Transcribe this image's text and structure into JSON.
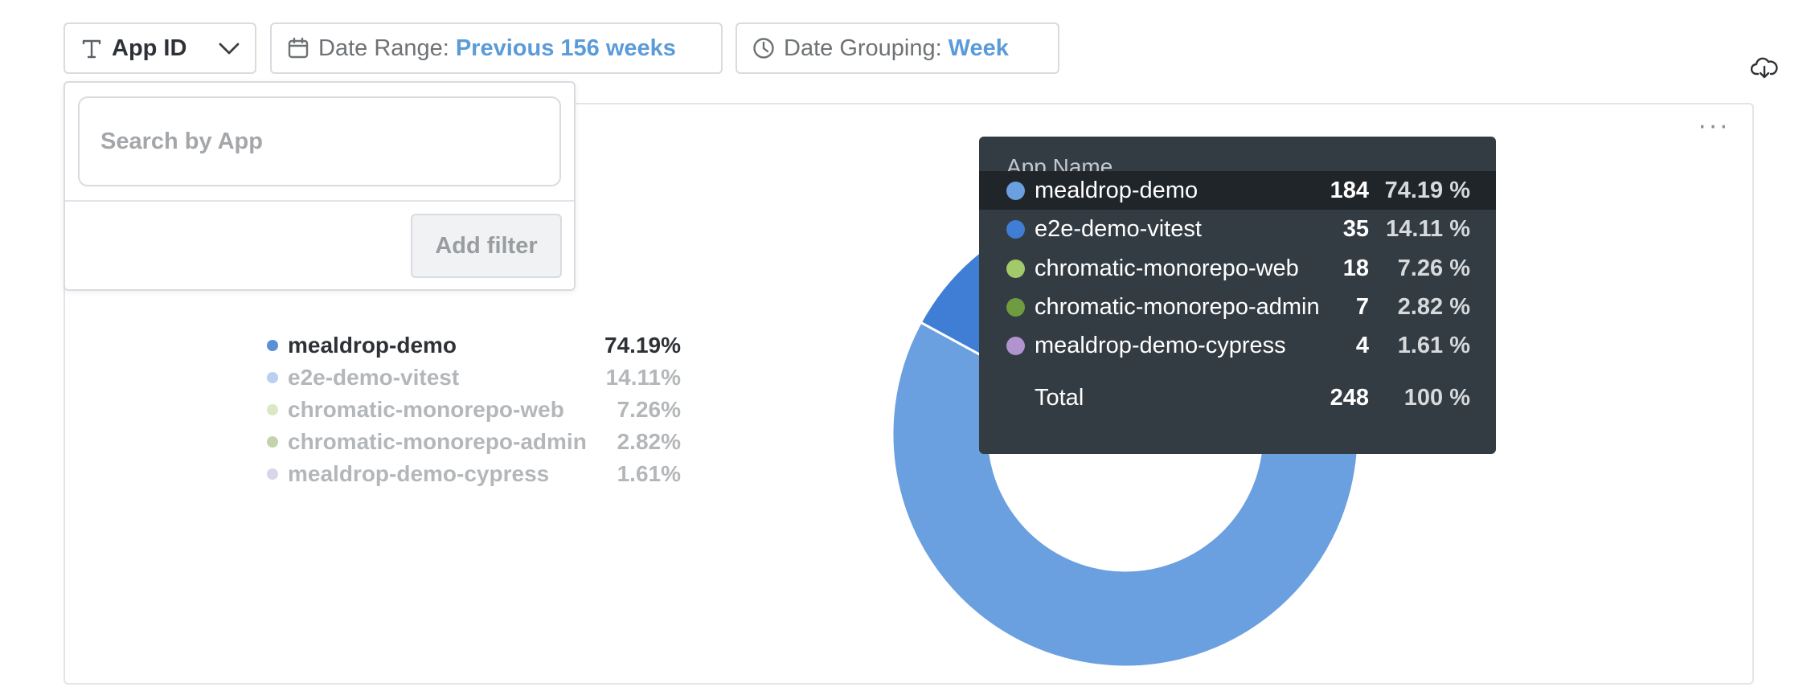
{
  "toolbar": {
    "app_id_label": "App ID",
    "date_range_label": "Date Range:",
    "date_range_value": "Previous 156 weeks",
    "date_grouping_label": "Date Grouping:",
    "date_grouping_value": "Week",
    "icons": {
      "app_id": "text-type-icon",
      "app_id_chevron": "chevron-down-icon",
      "date_range": "calendar-icon",
      "date_grouping": "clock-icon",
      "download": "cloud-download-icon",
      "more": "more-options-icon"
    }
  },
  "popover": {
    "search_placeholder": "Search by App",
    "add_filter_label": "Add filter"
  },
  "legend": {
    "items": [
      {
        "name": "mealdrop-demo",
        "pct": "74.19%",
        "color": "#5b8fd6",
        "active": true
      },
      {
        "name": "e2e-demo-vitest",
        "pct": "14.11%",
        "color": "#b9d0ef",
        "active": false
      },
      {
        "name": "chromatic-monorepo-web",
        "pct": "7.26%",
        "color": "#d9e9c4",
        "active": false
      },
      {
        "name": "chromatic-monorepo-admin",
        "pct": "2.82%",
        "color": "#c3d4ad",
        "active": false
      },
      {
        "name": "mealdrop-demo-cypress",
        "pct": "1.61%",
        "color": "#dcd4e8",
        "active": false
      }
    ]
  },
  "tooltip": {
    "header": "App Name",
    "rows": [
      {
        "name": "mealdrop-demo",
        "count": "184",
        "pct": "74.19 %",
        "color": "#6a9fe0",
        "highlight": true
      },
      {
        "name": "e2e-demo-vitest",
        "count": "35",
        "pct": "14.11 %",
        "color": "#3f7ed4",
        "highlight": false
      },
      {
        "name": "chromatic-monorepo-web",
        "count": "18",
        "pct": "7.26 %",
        "color": "#a2c96a",
        "highlight": false
      },
      {
        "name": "chromatic-monorepo-admin",
        "count": "7",
        "pct": "2.82 %",
        "color": "#6f9c40",
        "highlight": false
      },
      {
        "name": "mealdrop-demo-cypress",
        "count": "4",
        "pct": "1.61 %",
        "color": "#b193cf",
        "highlight": false
      }
    ],
    "total": {
      "label": "Total",
      "count": "248",
      "pct": "100 %"
    }
  },
  "chart_data": {
    "type": "pie",
    "categories": [
      "mealdrop-demo",
      "e2e-demo-vitest",
      "chromatic-monorepo-web",
      "chromatic-monorepo-admin",
      "mealdrop-demo-cypress"
    ],
    "values": [
      184,
      35,
      18,
      7,
      4
    ],
    "colors": [
      "#6a9fe0",
      "#3f7ed4",
      "#a2c96a",
      "#6f9c40",
      "#b193cf"
    ],
    "donut": true,
    "legend_position": "left"
  }
}
